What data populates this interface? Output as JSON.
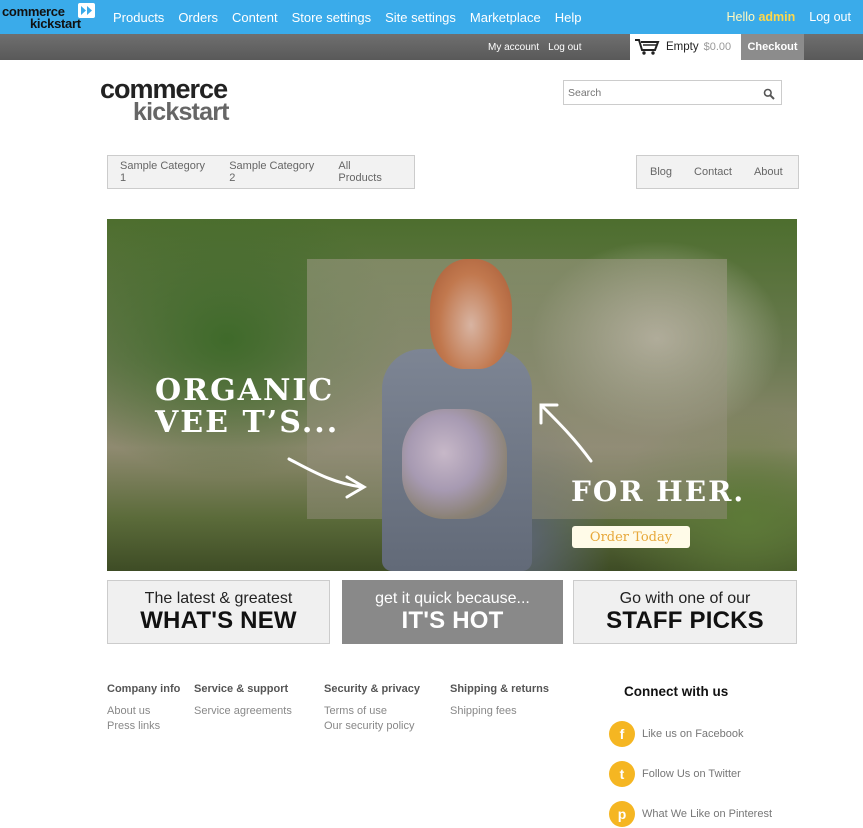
{
  "admin_bar": {
    "logo_line1": "commerce",
    "logo_line2": "kickstart",
    "menu": [
      "Products",
      "Orders",
      "Content",
      "Store settings",
      "Site settings",
      "Marketplace",
      "Help"
    ],
    "hello_prefix": "Hello ",
    "username": "admin",
    "logout": "Log out",
    "bg_color": "#3aabea"
  },
  "user_bar": {
    "my_account": "My account",
    "log_out": "Log out",
    "cart_status": "Empty",
    "cart_total": "$0.00",
    "checkout": "Checkout"
  },
  "header": {
    "logo_line1": "commerce",
    "logo_line2": "kickstart",
    "search_placeholder": "Search"
  },
  "nav_main": [
    "Sample Category 1",
    "Sample Category 2",
    "All Products"
  ],
  "nav_secondary": [
    "Blog",
    "Contact",
    "About"
  ],
  "hero": {
    "headline_line1": "ORGANIC",
    "headline_line2": "VEE T’S...",
    "headline_right": "FOR HER.",
    "cta": "Order Today"
  },
  "promos": [
    {
      "small": "The latest & greatest",
      "big": "WHAT'S NEW"
    },
    {
      "small": "get it quick because...",
      "big": "IT'S HOT"
    },
    {
      "small": "Go with one of our",
      "big": "STAFF PICKS"
    }
  ],
  "footer": {
    "columns": [
      {
        "title": "Company info",
        "links": [
          "About us",
          "Press links"
        ]
      },
      {
        "title": "Service & support",
        "links": [
          "Service agreements"
        ]
      },
      {
        "title": "Security & privacy",
        "links": [
          "Terms of use",
          "Our security policy"
        ]
      },
      {
        "title": "Shipping & returns",
        "links": [
          "Shipping fees"
        ]
      }
    ],
    "connect_title": "Connect with us",
    "social": [
      {
        "icon": "facebook-icon",
        "glyph": "f",
        "label": "Like us on Facebook"
      },
      {
        "icon": "twitter-icon",
        "glyph": "t",
        "label": "Follow Us on Twitter"
      },
      {
        "icon": "pinterest-icon",
        "glyph": "p",
        "label": "What We Like on Pinterest"
      }
    ],
    "accent_color": "#f5b622"
  }
}
